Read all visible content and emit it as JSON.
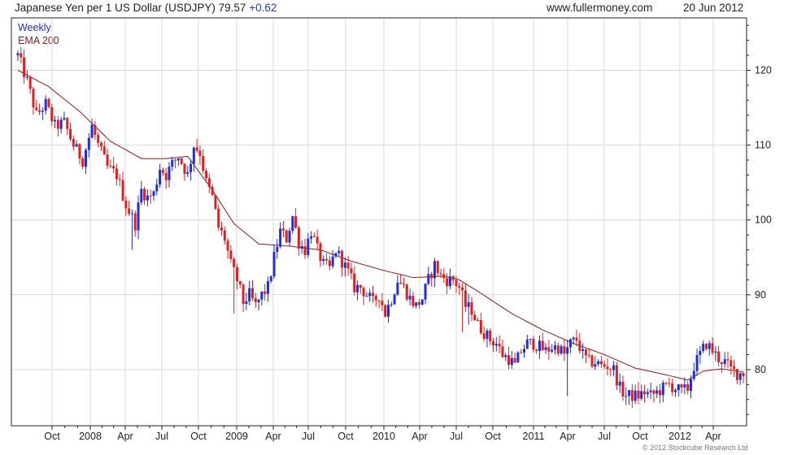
{
  "header": {
    "title": "Japanese Yen per 1 US Dollar (USDJPY)",
    "last": "79.57",
    "change": "+0.62",
    "site": "www.fullermoney.com",
    "date": "20 Jun 2012"
  },
  "legend": {
    "weekly": "Weekly",
    "ema": "EMA 200"
  },
  "copyright": "© 2012 Stockcube Research Ltd",
  "colors": {
    "up": "#1f2ed6",
    "down": "#e02020",
    "ema": "#8b1a1a",
    "grid": "#d8d8d8",
    "axis": "#222222"
  },
  "chart_data": {
    "type": "candlestick",
    "frequency": "weekly",
    "y_axis_side": "right",
    "ylim": [
      72.5,
      127
    ],
    "y_ticks": [
      80,
      90,
      100,
      110,
      120
    ],
    "x_ticks": [
      "Oct",
      "2008",
      "Apr",
      "Jul",
      "Oct",
      "2009",
      "Apr",
      "Jul",
      "Oct",
      "2010",
      "Apr",
      "Jul",
      "Oct",
      "2011",
      "Apr",
      "Jul",
      "Oct",
      "2012",
      "Apr"
    ],
    "grid": true,
    "series": [
      {
        "name": "Weekly",
        "kind": "ohlc",
        "anchors": [
          [
            0,
            122
          ],
          [
            3,
            118.5
          ],
          [
            6,
            114
          ],
          [
            9,
            115.5
          ],
          [
            12,
            112.5
          ],
          [
            15,
            113
          ],
          [
            18,
            110
          ],
          [
            21,
            108
          ],
          [
            24,
            112.5
          ],
          [
            26,
            110
          ],
          [
            29,
            107
          ],
          [
            32,
            106
          ],
          [
            35,
            102
          ],
          [
            38,
            99.5
          ],
          [
            40,
            104
          ],
          [
            42,
            103
          ],
          [
            44,
            103.5
          ],
          [
            46,
            107
          ],
          [
            48,
            106
          ],
          [
            50,
            107.5
          ],
          [
            52,
            108.5
          ],
          [
            55,
            106
          ],
          [
            57,
            110
          ],
          [
            59,
            109
          ],
          [
            61,
            105
          ],
          [
            63,
            103
          ],
          [
            65,
            99
          ],
          [
            67,
            97.5
          ],
          [
            69,
            94
          ],
          [
            71,
            92
          ],
          [
            73,
            89
          ],
          [
            75,
            90
          ],
          [
            77,
            88.5
          ],
          [
            79,
            90
          ],
          [
            81,
            91
          ],
          [
            83,
            95
          ],
          [
            85,
            98.5
          ],
          [
            87,
            97.5
          ],
          [
            89,
            100.5
          ],
          [
            91,
            97
          ],
          [
            93,
            96
          ],
          [
            95,
            98.5
          ],
          [
            97,
            96
          ],
          [
            99,
            94
          ],
          [
            101,
            93.5
          ],
          [
            103,
            96
          ],
          [
            105,
            94.5
          ],
          [
            107,
            93
          ],
          [
            109,
            91
          ],
          [
            111,
            91
          ],
          [
            113,
            90
          ],
          [
            115,
            89
          ],
          [
            117,
            90
          ],
          [
            119,
            87.5
          ],
          [
            121,
            89.5
          ],
          [
            123,
            92
          ],
          [
            125,
            91
          ],
          [
            127,
            89.5
          ],
          [
            129,
            88.5
          ],
          [
            131,
            89.5
          ],
          [
            133,
            92
          ],
          [
            135,
            94
          ],
          [
            137,
            92.5
          ],
          [
            139,
            92
          ],
          [
            141,
            92
          ],
          [
            143,
            91
          ],
          [
            145,
            88.5
          ],
          [
            147,
            88
          ],
          [
            149,
            86
          ],
          [
            151,
            85
          ],
          [
            153,
            84
          ],
          [
            155,
            83.5
          ],
          [
            157,
            82
          ],
          [
            159,
            81.5
          ],
          [
            161,
            80.5
          ],
          [
            163,
            82.5
          ],
          [
            165,
            83.5
          ],
          [
            167,
            83.5
          ],
          [
            169,
            83
          ],
          [
            171,
            82.5
          ],
          [
            173,
            83
          ],
          [
            175,
            83
          ],
          [
            177,
            82
          ],
          [
            179,
            83.5
          ],
          [
            181,
            84
          ],
          [
            183,
            82
          ],
          [
            185,
            81
          ],
          [
            187,
            81
          ],
          [
            189,
            80.5
          ],
          [
            191,
            80.5
          ],
          [
            193,
            80
          ],
          [
            195,
            77.5
          ],
          [
            197,
            76.5
          ],
          [
            199,
            76.5
          ],
          [
            201,
            76.5
          ],
          [
            203,
            77
          ],
          [
            205,
            76.5
          ],
          [
            207,
            77
          ],
          [
            209,
            77.5
          ],
          [
            211,
            78
          ],
          [
            213,
            77.5
          ],
          [
            215,
            77
          ],
          [
            217,
            77.5
          ],
          [
            219,
            80.5
          ],
          [
            221,
            82
          ],
          [
            223,
            83.5
          ],
          [
            225,
            82.5
          ],
          [
            227,
            81.5
          ],
          [
            229,
            81
          ],
          [
            231,
            80
          ],
          [
            233,
            79.5
          ],
          [
            235,
            79.6
          ]
        ]
      },
      {
        "name": "EMA 200",
        "kind": "line",
        "anchors": [
          [
            0,
            120
          ],
          [
            10,
            117.8
          ],
          [
            20,
            114.5
          ],
          [
            30,
            110.5
          ],
          [
            40,
            108.2
          ],
          [
            48,
            108.2
          ],
          [
            55,
            108.5
          ],
          [
            63,
            104
          ],
          [
            70,
            99.5
          ],
          [
            78,
            96.8
          ],
          [
            88,
            96.5
          ],
          [
            98,
            96
          ],
          [
            108,
            94.5
          ],
          [
            118,
            93.3
          ],
          [
            128,
            92.3
          ],
          [
            138,
            92.5
          ],
          [
            143,
            92
          ],
          [
            150,
            90.2
          ],
          [
            160,
            87.5
          ],
          [
            170,
            85.3
          ],
          [
            180,
            83.5
          ],
          [
            190,
            82
          ],
          [
            200,
            80.2
          ],
          [
            210,
            79.3
          ],
          [
            217,
            78.6
          ],
          [
            222,
            79.8
          ],
          [
            228,
            80.1
          ],
          [
            235,
            79.7
          ]
        ]
      }
    ]
  }
}
